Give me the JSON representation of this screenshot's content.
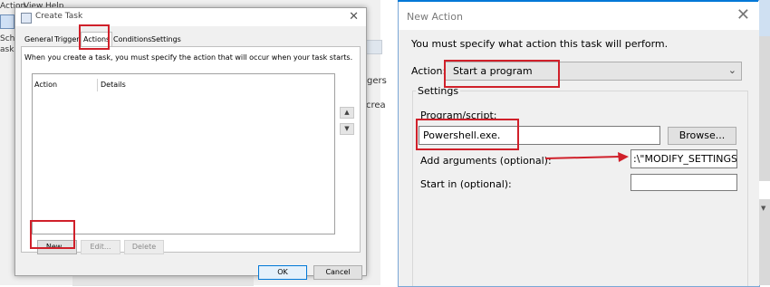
{
  "background_app": {
    "menu_action": "Action",
    "menu_view": "View",
    "menu_help": "Help",
    "left_sche": "Sche",
    "left_ask": "ask S",
    "gers": "gers",
    "crea": "crea"
  },
  "create_task": {
    "title": "Create Task",
    "tabs": [
      "General",
      "Triggers",
      "Actions",
      "Conditions",
      "Settings"
    ],
    "info": "When you create a task, you must specify the action that will occur when your task starts.",
    "columns": [
      "Action",
      "Details"
    ],
    "buttons": {
      "new": "New...",
      "edit": "Edit...",
      "delete": "Delete",
      "ok": "OK",
      "cancel": "Cancel"
    }
  },
  "new_action": {
    "title": "New Action",
    "instruction": "You must specify what action this task will perform.",
    "action_label": "Action:",
    "action_value": "Start a program",
    "settings_label": "Settings",
    "program_label": "Program/script:",
    "program_value": "Powershell.exe.",
    "browse_label": "Browse...",
    "args_label": "Add arguments (optional):",
    "args_value": ":\\\"MODIFY_SETTINGS\\\"\"",
    "startin_label": "Start in (optional):",
    "startin_value": ""
  },
  "colors": {
    "annotation_red": "#d0202a",
    "accent": "#0078d7"
  }
}
